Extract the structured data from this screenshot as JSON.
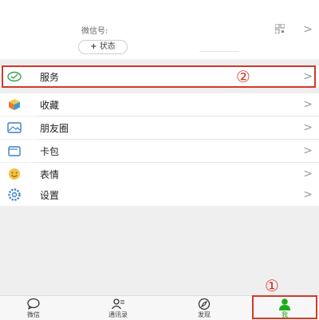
{
  "profile": {
    "wechat_id_label": "微信号:",
    "qr_icon": "qr-code-icon",
    "status_button": {
      "plus": "+",
      "label": "状态"
    }
  },
  "menu": [
    {
      "label": "服务",
      "icon": "wallet-check-icon",
      "icon_color": "#3aa14a"
    },
    {
      "label": "收藏",
      "icon": "favorites-cube-icon",
      "icon_color": "#e0a52b"
    },
    {
      "label": "朋友圈",
      "icon": "moments-photo-icon",
      "icon_color": "#3b7fc7"
    },
    {
      "label": "卡包",
      "icon": "card-wallet-icon",
      "icon_color": "#3b7fc7"
    },
    {
      "label": "表情",
      "icon": "emoji-smile-icon",
      "icon_color": "#e8a23a"
    },
    {
      "label": "设置",
      "icon": "settings-gear-icon",
      "icon_color": "#3b7fc7"
    }
  ],
  "chevron": ">",
  "annotations": {
    "one": "①",
    "two": "②",
    "color": "#d23a2a"
  },
  "tabbar": {
    "tabs": [
      {
        "label": "微信",
        "icon": "chat-bubble-icon"
      },
      {
        "label": "通讯录",
        "icon": "contacts-icon"
      },
      {
        "label": "发现",
        "icon": "compass-icon"
      },
      {
        "label": "我",
        "icon": "me-person-icon",
        "active": true
      }
    ],
    "active_color": "#1aad19"
  }
}
